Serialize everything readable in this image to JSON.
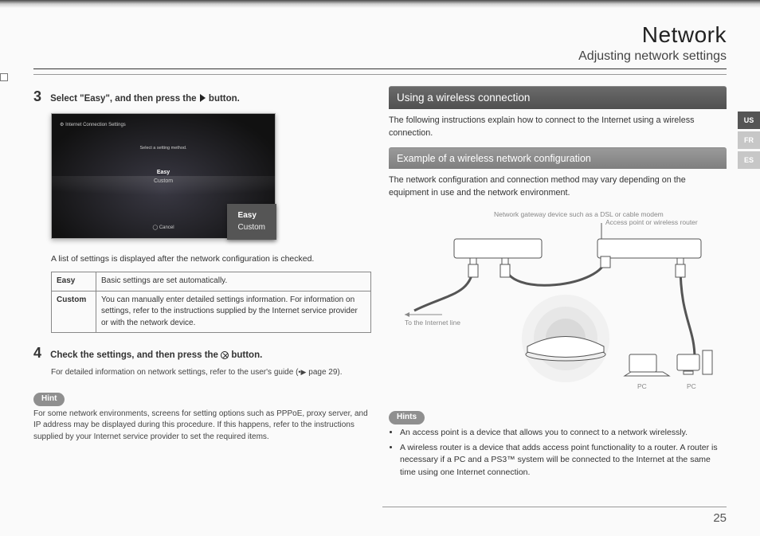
{
  "header": {
    "title": "Network",
    "subtitle": "Adjusting network settings"
  },
  "lang_tabs": {
    "us": "US",
    "fr": "FR",
    "es": "ES",
    "active": "US"
  },
  "page_number": "25",
  "left": {
    "step3": {
      "num": "3",
      "text_a": "Select \"Easy\", and then press the ",
      "text_b": " button.",
      "ss": {
        "title_icon": "⚙",
        "title": "Internet Connection Settings",
        "prompt": "Select a setting method.",
        "opt_easy": "Easy",
        "opt_custom": "Custom",
        "cancel": "◯ Cancel"
      },
      "callout": {
        "easy": "Easy",
        "custom": "Custom"
      },
      "caption": "A list of settings is displayed after the network configuration is checked.",
      "table": {
        "easy_label": "Easy",
        "easy_desc": "Basic settings are set automatically.",
        "custom_label": "Custom",
        "custom_desc": "You can manually enter detailed settings information. For information on settings, refer to the instructions supplied by the Internet service provider or with the network device."
      }
    },
    "step4": {
      "num": "4",
      "text_a": "Check the settings, and then press the ",
      "text_b": " button.",
      "sub": "For detailed information on network settings, refer to the user's guide (  page 29).",
      "ref": "•▶"
    },
    "hint": {
      "label": "Hint",
      "text": "For some network environments, screens for setting options such as PPPoE, proxy server, and IP address may be displayed during this procedure. If this happens, refer to the instructions supplied by your Internet service provider to set the required items."
    }
  },
  "right": {
    "sec1": {
      "title": "Using a wireless connection",
      "para": "The following instructions explain how to connect to the Internet using a wireless connection."
    },
    "sec2": {
      "title": "Example of a wireless network configuration",
      "para": "The network configuration and connection method may vary depending on the equipment in use and the network environment."
    },
    "diagram": {
      "gw_label": "Network gateway device such as a DSL or cable modem",
      "ap_label": "Access point or wireless router",
      "internet_label": "To the Internet line",
      "pc1": "PC",
      "pc2": "PC"
    },
    "hints": {
      "label": "Hints",
      "b1": "An access point is a device that allows you to connect to a network wirelessly.",
      "b2": "A wireless router is a device that adds access point functionality to a router. A router is necessary if a PC and a PS3™ system will be connected to the Internet at the same time using one Internet connection."
    }
  }
}
